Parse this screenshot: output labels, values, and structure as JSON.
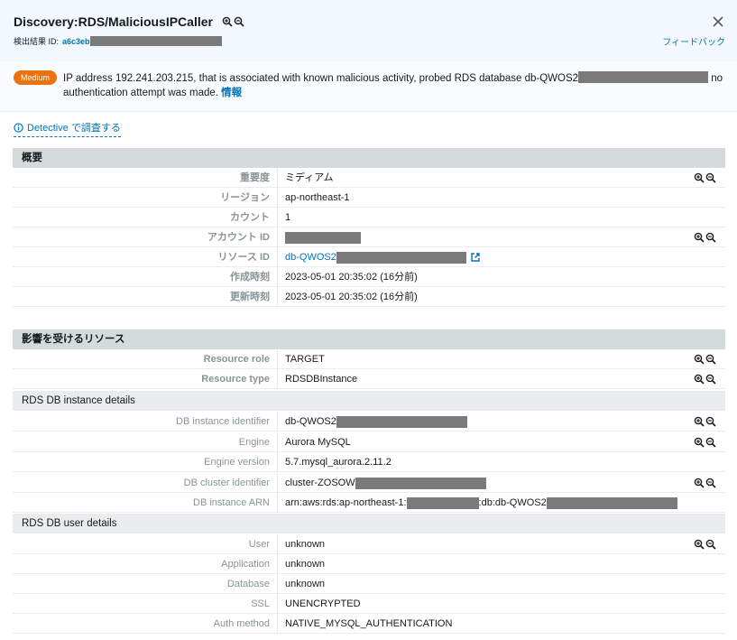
{
  "header": {
    "title": "Discovery:RDS/MaliciousIPCaller",
    "finding_id_label": "検出結果 ID:",
    "finding_id_value": "a6c3eb",
    "feedback": "フィードバック"
  },
  "description": {
    "severity_badge": "Medium",
    "text_a": "IP address 192.241.203.215, that is associated with known malicious activity, probed RDS database db-QWOS2",
    "text_b": " no authentication attempt was made.",
    "info_link": "情報"
  },
  "detective_link": "Detective で調査する",
  "overview": {
    "heading": "概要",
    "rows": [
      {
        "label": "重要度",
        "value": "ミディアム"
      },
      {
        "label": "リージョン",
        "value": "ap-northeast-1"
      },
      {
        "label": "カウント",
        "value": "1"
      },
      {
        "label": "アカウント ID",
        "value": ""
      },
      {
        "label": "リソース ID",
        "value": "db-QWOS2"
      },
      {
        "label": "作成時刻",
        "value": "2023-05-01 20:35:02 (16分前)"
      },
      {
        "label": "更新時刻",
        "value": "2023-05-01 20:35:02 (16分前)"
      }
    ]
  },
  "affected": {
    "heading": "影響を受けるリソース",
    "rows": [
      {
        "label": "Resource role",
        "value": "TARGET"
      },
      {
        "label": "Resource type",
        "value": "RDSDBInstance"
      }
    ],
    "instance_heading": "RDS DB instance details",
    "instance_rows": [
      {
        "label": "DB instance identifier",
        "value": "db-QWOS2"
      },
      {
        "label": "Engine",
        "value": "Aurora MySQL"
      },
      {
        "label": "Engine version",
        "value": "5.7.mysql_aurora.2.11.2"
      },
      {
        "label": "DB cluster identifier",
        "value": "cluster-ZOSOW"
      },
      {
        "label": "DB instance ARN",
        "value_a": "arn:aws:rds:ap-northeast-1:",
        "value_b": ":db:db-QWOS2"
      }
    ],
    "user_heading": "RDS DB user details",
    "user_rows": [
      {
        "label": "User",
        "value": "unknown"
      },
      {
        "label": "Application",
        "value": "unknown"
      },
      {
        "label": "Database",
        "value": "unknown"
      },
      {
        "label": "SSL",
        "value": "UNENCRYPTED"
      },
      {
        "label": "Auth method",
        "value": "NATIVE_MYSQL_AUTHENTICATION"
      }
    ]
  },
  "colors": {
    "link": "#0073bb",
    "badge": "#ec7211",
    "section_bg": "#d5dbdb",
    "header_bg": "#f2f8fd"
  },
  "icons": [
    "zoom-in-icon",
    "zoom-out-icon",
    "close-icon",
    "info-icon",
    "external-link-icon"
  ]
}
